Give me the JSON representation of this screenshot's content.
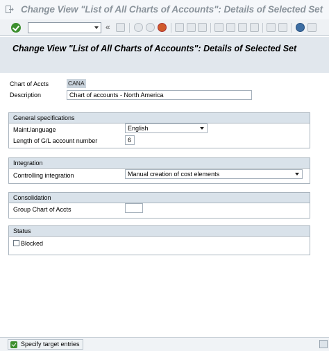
{
  "window": {
    "title": "Change View \"List of All Charts of Accounts\": Details of Selected Set"
  },
  "toolbar": {
    "command_value": "",
    "icons": [
      "enter-icon",
      "back-icon",
      "exit-icon",
      "cancel-icon",
      "print-icon",
      "find-icon",
      "find-next-icon",
      "first-page-icon",
      "previous-page-icon",
      "next-page-icon",
      "last-page-icon",
      "create-session-icon",
      "shortcut-icon",
      "help-icon",
      "customize-layout-icon"
    ],
    "double_arrow": "«"
  },
  "header": {
    "title": "Change View \"List of All Charts of Accounts\": Details of Selected Set"
  },
  "fields": {
    "chart_of_accts_label": "Chart of Accts",
    "chart_of_accts_value": "CANA",
    "description_label": "Description",
    "description_value": "Chart of accounts - North America"
  },
  "general": {
    "heading": "General specifications",
    "maint_language_label": "Maint.language",
    "maint_language_value": "English",
    "gl_length_label": "Length of G/L account number",
    "gl_length_value": "6"
  },
  "integration": {
    "heading": "Integration",
    "controlling_label": "Controlling integration",
    "controlling_value": "Manual creation of cost elements"
  },
  "consolidation": {
    "heading": "Consolidation",
    "group_coa_label": "Group Chart of Accts",
    "group_coa_value": ""
  },
  "status": {
    "heading": "Status",
    "blocked_label": "Blocked",
    "blocked_checked": false
  },
  "footer": {
    "specify_label": "Specify target entries"
  }
}
